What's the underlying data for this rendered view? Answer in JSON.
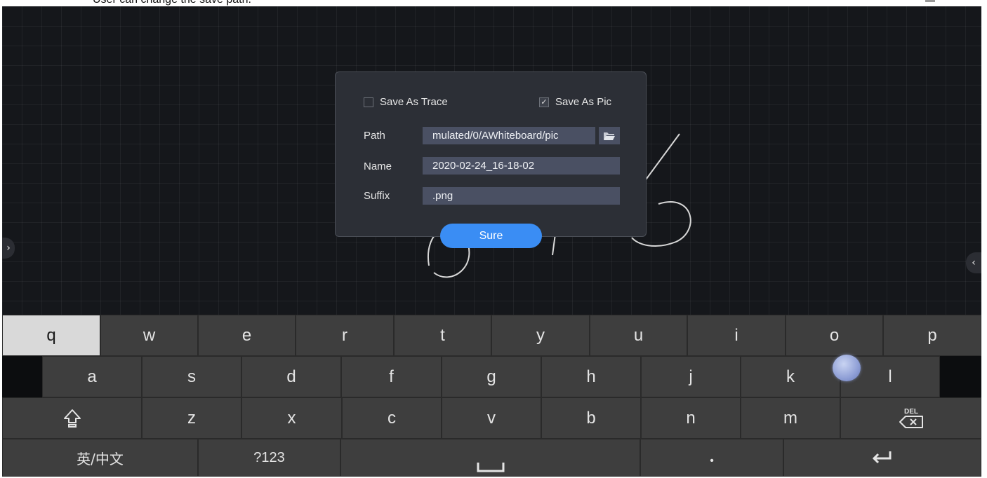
{
  "caption": "User can change the save path.",
  "dialog": {
    "save_as_trace": {
      "label": "Save As Trace",
      "checked": false
    },
    "save_as_pic": {
      "label": "Save As Pic",
      "checked": true
    },
    "path": {
      "label": "Path",
      "value": "mulated/0/AWhiteboard/pic"
    },
    "name": {
      "label": "Name",
      "value": "2020-02-24_16-18-02"
    },
    "suffix": {
      "label": "Suffix",
      "value": ".png"
    },
    "sure_label": "Sure",
    "check_glyph": "✓"
  },
  "side": {
    "left": "›",
    "right": "‹"
  },
  "keyboard": {
    "row1": [
      "q",
      "w",
      "e",
      "r",
      "t",
      "y",
      "u",
      "i",
      "o",
      "p"
    ],
    "row2": [
      "a",
      "s",
      "d",
      "f",
      "g",
      "h",
      "j",
      "k",
      "l"
    ],
    "row3": [
      "z",
      "x",
      "c",
      "v",
      "b",
      "n",
      "m"
    ],
    "lang": "英/中文",
    "symbols": "?123",
    "dot": "•",
    "shift_icon": "shift-icon",
    "delete_icon": "del-icon",
    "space_icon": "space-icon",
    "enter_icon": "enter-icon"
  },
  "colors": {
    "board": "#15171b",
    "dialog": "#2c2f36",
    "field": "#4a5063",
    "accent": "#3a8df4",
    "key": "#3e3e3e",
    "key_pressed": "#d9d9d9"
  }
}
